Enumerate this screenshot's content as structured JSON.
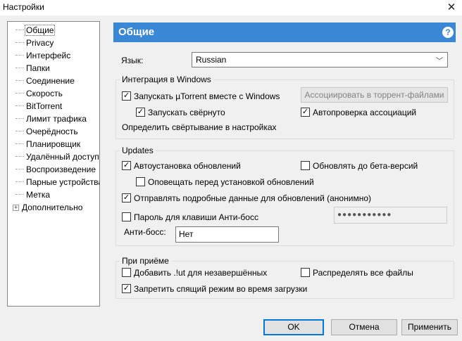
{
  "window": {
    "title": "Настройки",
    "close": "✕"
  },
  "tree": {
    "items": [
      {
        "label": "Общие",
        "selected": true
      },
      {
        "label": "Privacy"
      },
      {
        "label": "Интерфейс"
      },
      {
        "label": "Папки"
      },
      {
        "label": "Соединение"
      },
      {
        "label": "Скорость"
      },
      {
        "label": "BitTorrent"
      },
      {
        "label": "Лимит трафика"
      },
      {
        "label": "Очерёдность"
      },
      {
        "label": "Планировщик"
      },
      {
        "label": "Удалённый доступ"
      },
      {
        "label": "Воспроизведение"
      },
      {
        "label": "Парные устройства"
      },
      {
        "label": "Метка"
      },
      {
        "label": "Дополнительно",
        "expander": "+"
      }
    ]
  },
  "header": {
    "title": "Общие",
    "help_icon": "?"
  },
  "language": {
    "label": "Язык:",
    "value": "Russian",
    "arrow": "﹀"
  },
  "windows_integration": {
    "legend": "Интеграция в Windows",
    "start_with_windows": {
      "label": "Запускать µTorrent вместе с Windows",
      "checked": "✓"
    },
    "associate_button": "Ассоциировать в торрент-файлами",
    "start_minimized": {
      "label": "Запускать свёрнуто",
      "checked": "✓"
    },
    "check_associations": {
      "label": "Автопроверка ассоциаций",
      "checked": "✓"
    },
    "minimize_note": "Определить свёртывание в настройках"
  },
  "updates": {
    "legend": "Updates",
    "auto_install": {
      "label": "Автоустановка обновлений",
      "checked": "✓"
    },
    "beta": {
      "label": "Обновлять до бета-версий",
      "checked": ""
    },
    "notify_before": {
      "label": "Оповещать перед установкой обновлений",
      "checked": ""
    },
    "send_data": {
      "label": "Отправлять подробные данные для обновлений (анонимно)",
      "checked": "✓"
    },
    "boss_password": {
      "label": "Пароль для клавиши Анти-босс",
      "checked": "",
      "value": "●●●●●●●●●●●"
    },
    "boss_key_label": "Анти-босс:",
    "boss_key_value": "Нет"
  },
  "on_download": {
    "legend": "При приёме",
    "append_ut": {
      "label": "Добавить .!ut для незавершённых",
      "checked": ""
    },
    "preallocate": {
      "label": "Распределять все файлы",
      "checked": ""
    },
    "prevent_sleep": {
      "label": "Запретить спящий режим во время загрузки",
      "checked": "✓"
    }
  },
  "buttons": {
    "ok": "OK",
    "cancel": "Отмена",
    "apply": "Применить"
  }
}
